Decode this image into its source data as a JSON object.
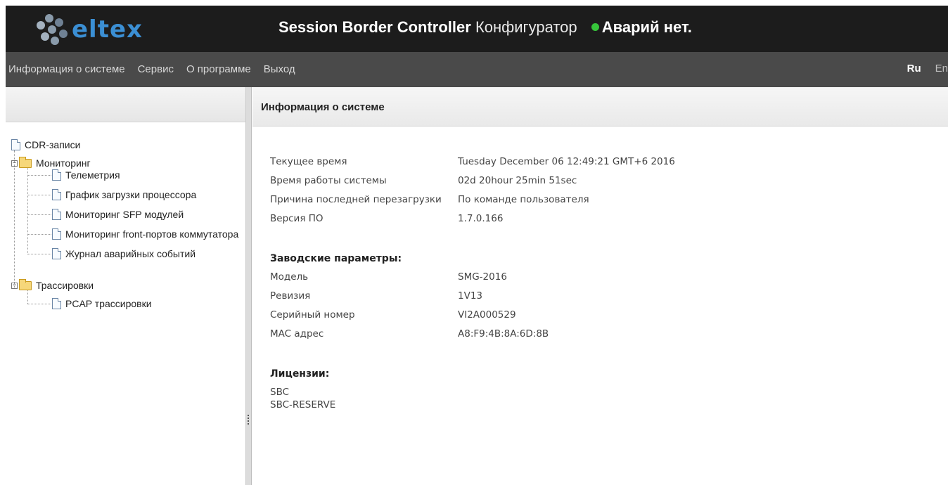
{
  "header": {
    "logo_text": "eltex",
    "title_brand": "Session Border Controller",
    "title_sub": "Конфигуратор",
    "alarm_text": "Аварий нет.",
    "alarm_color": "#36c43a"
  },
  "menu": {
    "items": [
      "Информация о системе",
      "Сервис",
      "О программе",
      "Выход"
    ],
    "lang_ru": "Ru",
    "lang_en": "En"
  },
  "tree": {
    "cdr": "CDR-записи",
    "monitoring": "Мониторинг",
    "monitoring_children": [
      "Телеметрия",
      "График загрузки процессора",
      "Мониторинг SFP модулей",
      "Мониторинг front-портов коммутатора",
      "Журнал аварийных событий"
    ],
    "traces": "Трассировки",
    "traces_children": [
      "PCAP трассировки"
    ]
  },
  "panel": {
    "title": "Информация о системе",
    "system": [
      {
        "key": "Текущее время",
        "value": "Tuesday December 06 12:49:21 GMT+6 2016"
      },
      {
        "key": "Время работы системы",
        "value": "02d 20hour 25min 51sec"
      },
      {
        "key": "Причина последней перезагрузки",
        "value": "По команде пользователя"
      },
      {
        "key": "Версия ПО",
        "value": "1.7.0.166"
      }
    ],
    "factory_title": "Заводские параметры:",
    "factory": [
      {
        "key": "Модель",
        "value": "SMG-2016"
      },
      {
        "key": "Ревизия",
        "value": "1V13"
      },
      {
        "key": "Серийный номер",
        "value": "VI2A000529"
      },
      {
        "key": "MAC адрес",
        "value": "A8:F9:4B:8A:6D:8B"
      }
    ],
    "licenses_title": "Лицензии:",
    "licenses": [
      "SBC",
      "SBC-RESERVE"
    ]
  }
}
